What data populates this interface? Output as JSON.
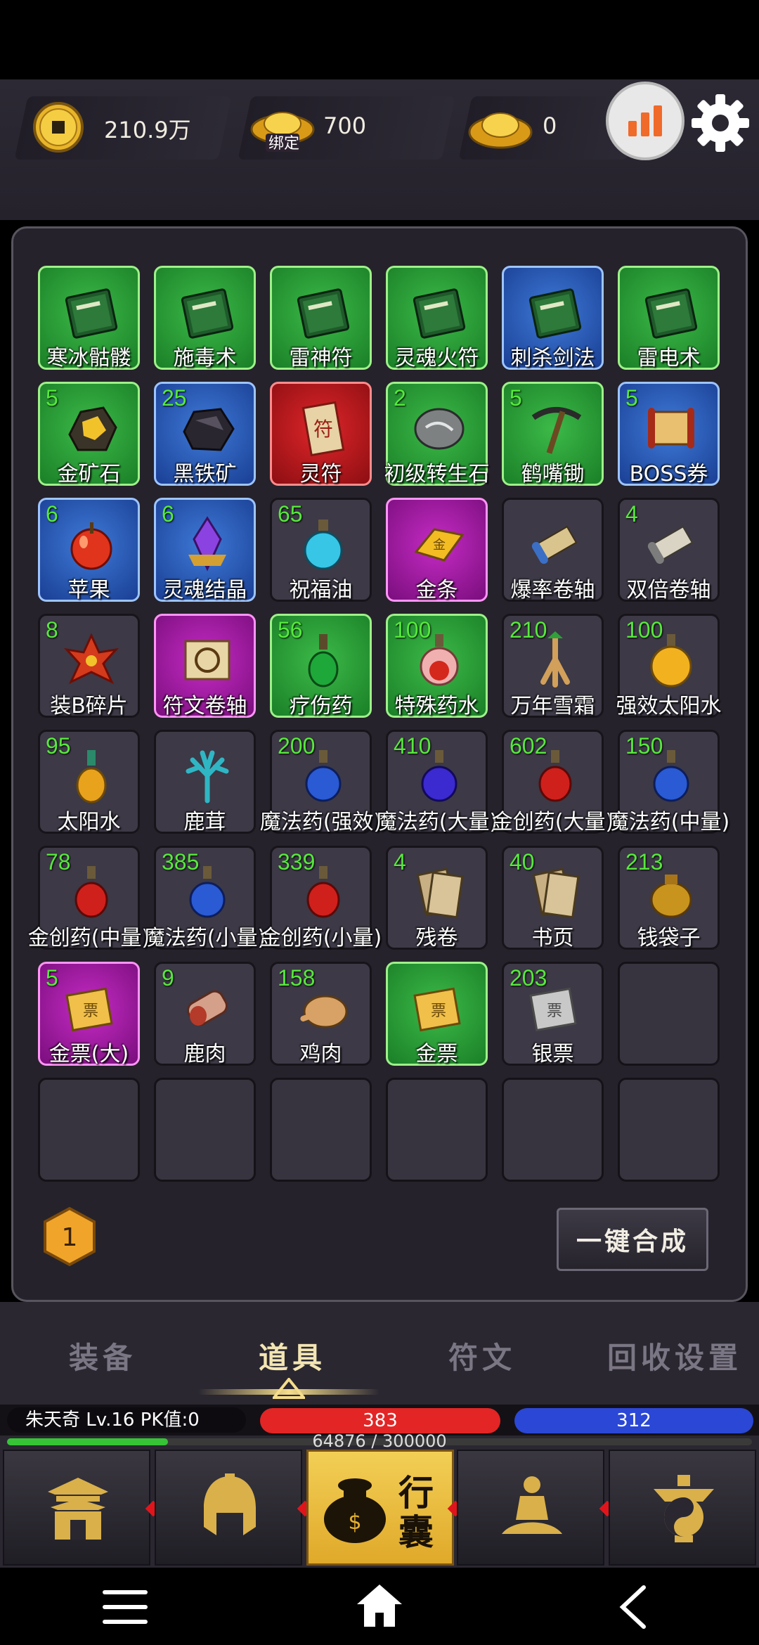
{
  "currency": [
    {
      "name": "copper-coin",
      "value": "210.9万"
    },
    {
      "name": "bound-gold-ingot",
      "badge": "绑定",
      "value": "700"
    },
    {
      "name": "gold-ingot",
      "value": "0"
    }
  ],
  "inventory": {
    "items": [
      {
        "name": "寒冰骷髅",
        "qty": "",
        "rarity": "green",
        "icon": "book-icon"
      },
      {
        "name": "施毒术",
        "qty": "",
        "rarity": "green",
        "icon": "book-icon"
      },
      {
        "name": "雷神符",
        "qty": "",
        "rarity": "green",
        "icon": "book-icon"
      },
      {
        "name": "灵魂火符",
        "qty": "",
        "rarity": "green",
        "icon": "book-icon"
      },
      {
        "name": "刺杀剑法",
        "qty": "",
        "rarity": "blue",
        "icon": "book-icon"
      },
      {
        "name": "雷电术",
        "qty": "",
        "rarity": "green",
        "icon": "book-icon"
      },
      {
        "name": "金矿石",
        "qty": "5",
        "rarity": "green",
        "icon": "gold-ore-icon"
      },
      {
        "name": "黑铁矿",
        "qty": "25",
        "rarity": "blue",
        "icon": "iron-ore-icon"
      },
      {
        "name": "灵符",
        "qty": "",
        "rarity": "red",
        "icon": "talisman-icon"
      },
      {
        "name": "初级转生石",
        "qty": "2",
        "rarity": "green",
        "icon": "stone-icon"
      },
      {
        "name": "鹤嘴锄",
        "qty": "5",
        "rarity": "green",
        "icon": "pickaxe-icon"
      },
      {
        "name": "BOSS券",
        "qty": "5",
        "rarity": "blue",
        "icon": "scroll-icon"
      },
      {
        "name": "苹果",
        "qty": "6",
        "rarity": "blue",
        "icon": "apple-icon"
      },
      {
        "name": "灵魂结晶",
        "qty": "6",
        "rarity": "blue",
        "icon": "crystal-icon"
      },
      {
        "name": "祝福油",
        "qty": "65",
        "rarity": "gray",
        "icon": "potion-cyan-icon"
      },
      {
        "name": "金条",
        "qty": "",
        "rarity": "purple",
        "icon": "gold-bar-icon"
      },
      {
        "name": "爆率卷轴",
        "qty": "",
        "rarity": "gray",
        "icon": "scroll-blue-icon"
      },
      {
        "name": "双倍卷轴",
        "qty": "4",
        "rarity": "gray",
        "icon": "scroll-gray-icon"
      },
      {
        "name": "装B碎片",
        "qty": "8",
        "rarity": "gray",
        "icon": "fragment-icon"
      },
      {
        "name": "符文卷轴",
        "qty": "",
        "rarity": "purple",
        "icon": "rune-scroll-icon"
      },
      {
        "name": "疗伤药",
        "qty": "56",
        "rarity": "green",
        "icon": "potion-green-icon"
      },
      {
        "name": "特殊药水",
        "qty": "100",
        "rarity": "green",
        "icon": "potion-pink-icon"
      },
      {
        "name": "万年雪霜",
        "qty": "210",
        "rarity": "gray",
        "icon": "ginseng-icon"
      },
      {
        "name": "强效太阳水",
        "qty": "100",
        "rarity": "gray",
        "icon": "potion-gold-icon"
      },
      {
        "name": "太阳水",
        "qty": "95",
        "rarity": "gray",
        "icon": "potion-yellow-icon"
      },
      {
        "name": "鹿茸",
        "qty": "",
        "rarity": "gray",
        "icon": "antler-icon"
      },
      {
        "name": "魔法药(强效)",
        "qty": "200",
        "rarity": "gray",
        "icon": "potion-blue-icon"
      },
      {
        "name": "魔法药(大量)",
        "qty": "410",
        "rarity": "gray",
        "icon": "potion-indigo-icon"
      },
      {
        "name": "金创药(大量)",
        "qty": "602",
        "rarity": "gray",
        "icon": "potion-red-icon"
      },
      {
        "name": "魔法药(中量)",
        "qty": "150",
        "rarity": "gray",
        "icon": "potion-blue-icon"
      },
      {
        "name": "金创药(中量)",
        "qty": "78",
        "rarity": "gray",
        "icon": "potion-red-icon"
      },
      {
        "name": "魔法药(小量)",
        "qty": "385",
        "rarity": "gray",
        "icon": "potion-blue-icon"
      },
      {
        "name": "金创药(小量)",
        "qty": "339",
        "rarity": "gray",
        "icon": "potion-red-icon"
      },
      {
        "name": "残卷",
        "qty": "4",
        "rarity": "gray",
        "icon": "pages-icon"
      },
      {
        "name": "书页",
        "qty": "40",
        "rarity": "gray",
        "icon": "pages-icon"
      },
      {
        "name": "钱袋子",
        "qty": "213",
        "rarity": "gray",
        "icon": "money-bag-icon"
      },
      {
        "name": "金票(大)",
        "qty": "5",
        "rarity": "purple",
        "icon": "ticket-gold-icon"
      },
      {
        "name": "鹿肉",
        "qty": "9",
        "rarity": "gray",
        "icon": "meat-icon"
      },
      {
        "name": "鸡肉",
        "qty": "158",
        "rarity": "gray",
        "icon": "chicken-icon"
      },
      {
        "name": "金票",
        "qty": "",
        "rarity": "green",
        "icon": "ticket-gold-icon"
      },
      {
        "name": "银票",
        "qty": "203",
        "rarity": "gray",
        "icon": "ticket-silver-icon"
      },
      {
        "name": "",
        "qty": "",
        "rarity": "empty",
        "icon": ""
      },
      {
        "name": "",
        "qty": "",
        "rarity": "empty",
        "icon": ""
      },
      {
        "name": "",
        "qty": "",
        "rarity": "empty",
        "icon": ""
      },
      {
        "name": "",
        "qty": "",
        "rarity": "empty",
        "icon": ""
      },
      {
        "name": "",
        "qty": "",
        "rarity": "empty",
        "icon": ""
      },
      {
        "name": "",
        "qty": "",
        "rarity": "empty",
        "icon": ""
      },
      {
        "name": "",
        "qty": "",
        "rarity": "empty",
        "icon": ""
      }
    ],
    "page_badge": "1",
    "merge_button": "一键合成"
  },
  "tabs": [
    {
      "label": "装备",
      "active": false
    },
    {
      "label": "道具",
      "active": true
    },
    {
      "label": "符文",
      "active": false
    },
    {
      "label": "回收设置",
      "active": false
    }
  ],
  "player": {
    "info": "朱天奇  Lv.16 PK值:0",
    "hp": "383",
    "mp": "312",
    "exp_text": "64876 / 300000",
    "exp_fraction": 0.216
  },
  "nav": {
    "bag_label": "行囊",
    "items": [
      "city-gate-icon",
      "helmet-icon",
      "bag-icon",
      "meditation-icon",
      "taiji-icon"
    ],
    "active_index": 2
  },
  "colors": {
    "green_qty": "#57e83d",
    "hp": "#e32525",
    "mp": "#2b47d6",
    "accent_gold": "#f2cf55"
  }
}
